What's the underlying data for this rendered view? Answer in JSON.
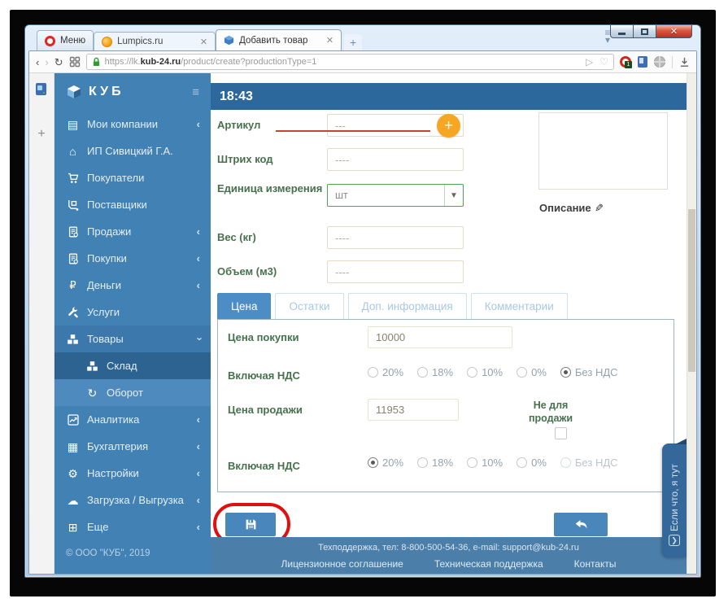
{
  "browser": {
    "menu_button": "Меню",
    "tabs": [
      {
        "title": "Lumpics.ru"
      },
      {
        "title": "Добавить товар"
      }
    ],
    "new_tab_label": "+",
    "url": {
      "prefix": "https://lk.",
      "domain": "kub-24.ru",
      "path": "/product/create?productionType=1"
    }
  },
  "sidebar": {
    "logo": "КУБ",
    "items": [
      {
        "label": "Мои компании"
      },
      {
        "label": "ИП Сивицкий Г.А."
      },
      {
        "label": "Покупатели"
      },
      {
        "label": "Поставщики"
      },
      {
        "label": "Продажи"
      },
      {
        "label": "Покупки"
      },
      {
        "label": "Деньги"
      },
      {
        "label": "Услуги"
      },
      {
        "label": "Товары"
      },
      {
        "label": "Склад"
      },
      {
        "label": "Оборот"
      },
      {
        "label": "Аналитика"
      },
      {
        "label": "Бухгалтерия"
      },
      {
        "label": "Настройки"
      },
      {
        "label": "Загрузка / Выгрузка"
      },
      {
        "label": "Еще"
      }
    ],
    "copyright": "© ООО \"КУБ\", 2019"
  },
  "header": {
    "time": "18:43"
  },
  "form": {
    "fields": {
      "artikul": {
        "label": "Артикул",
        "placeholder": "---"
      },
      "barcode": {
        "label": "Штрих код",
        "placeholder": "----"
      },
      "unit": {
        "label": "Единица измерения",
        "value": "шт"
      },
      "weight": {
        "label": "Вес (кг)",
        "placeholder": "----"
      },
      "volume": {
        "label": "Объем (м3)",
        "placeholder": "----"
      },
      "description_label": "Описание"
    },
    "tabs": [
      {
        "label": "Цена"
      },
      {
        "label": "Остатки"
      },
      {
        "label": "Доп. информация"
      },
      {
        "label": "Комментарии"
      }
    ],
    "price_tab": {
      "purchase_price_label": "Цена покупки",
      "purchase_price_value": "10000",
      "vat_label_1": "Включая НДС",
      "vat_label_2": "Включая НДС",
      "vat_options": [
        "20%",
        "18%",
        "10%",
        "0%",
        "Без НДС"
      ],
      "purchase_vat_selected": "Без НДС",
      "sale_price_label": "Цена продажи",
      "sale_price_value": "11953",
      "not_for_sale_label": "Не для продажи",
      "sale_vat_selected": "20%"
    }
  },
  "footer": {
    "support": "Техподдержка, тел: 8-800-500-54-36, e-mail: support@kub-24.ru",
    "links": [
      "Лицензионное соглашение",
      "Техническая поддержка",
      "Контакты"
    ]
  },
  "chat": {
    "label": "Если что, я тут"
  },
  "colors": {
    "sidebar_blue": "#4281b4",
    "header_blue": "#2d689c",
    "active_tab_blue": "#4d8dc6",
    "label_green": "#47714d",
    "annotation_red": "#e01010",
    "plus_orange": "#f5a623",
    "select_green": "#4da64d"
  }
}
